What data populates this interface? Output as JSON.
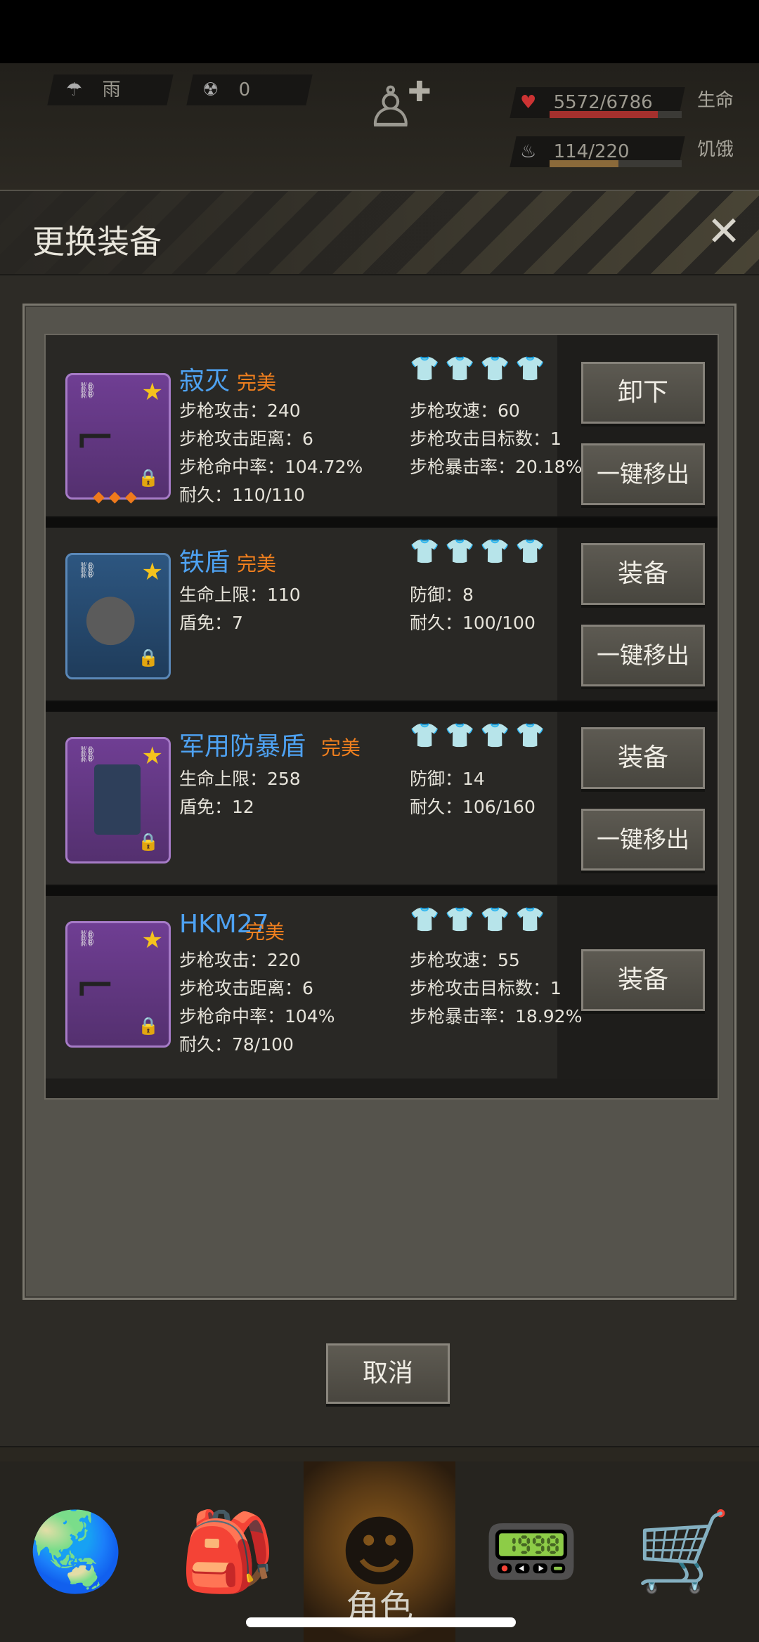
{
  "hud": {
    "weather": "雨",
    "radiation": "0",
    "hp_value": "5572/6786",
    "hp_label": "生命",
    "hp_fraction": 0.82,
    "hunger_value": "114/220",
    "hunger_label": "饥饿",
    "hunger_fraction": 0.52
  },
  "modal": {
    "title": "更换装备",
    "close": "✕",
    "cancel": "取消"
  },
  "items": [
    {
      "name": "寂灭",
      "quality": "完美",
      "stats_left": [
        "步枪攻击：240",
        "步枪攻击距离：6",
        "步枪命中率：104.72%",
        "耐久：110/110"
      ],
      "stats_right": [
        "步枪攻速：60",
        "步枪攻击目标数：1",
        "步枪暴击率：20.18%"
      ],
      "slots": [
        false,
        false,
        false,
        true
      ],
      "buttons": [
        "卸下",
        "一键移出"
      ]
    },
    {
      "name": "铁盾",
      "quality": "完美",
      "stats_left": [
        "生命上限：110",
        "盾免：7"
      ],
      "stats_right": [
        "防御：8",
        "耐久：100/100"
      ],
      "slots": [
        true,
        false,
        true,
        false
      ],
      "buttons": [
        "装备",
        "一键移出"
      ]
    },
    {
      "name": "军用防暴盾",
      "quality": "完美",
      "stats_left": [
        "生命上限：258",
        "盾免：12"
      ],
      "stats_right": [
        "防御：14",
        "耐久：106/160"
      ],
      "slots": [
        false,
        true,
        false,
        false
      ],
      "buttons": [
        "装备",
        "一键移出"
      ]
    },
    {
      "name": "HKM27",
      "quality": "完美",
      "stats_left": [
        "步枪攻击：220",
        "步枪攻击距离：6",
        "步枪命中率：104%",
        "耐久：78/100"
      ],
      "stats_right": [
        "步枪攻速：55",
        "步枪攻击目标数：1",
        "步枪暴击率：18.92%"
      ],
      "slots": [
        false,
        false,
        false,
        false
      ],
      "buttons": [
        "装备"
      ]
    }
  ],
  "nav": {
    "active_label": "角色",
    "icons": [
      "globe-icon",
      "backpack-icon",
      "character-icon",
      "radio-icon",
      "cart-icon"
    ]
  }
}
